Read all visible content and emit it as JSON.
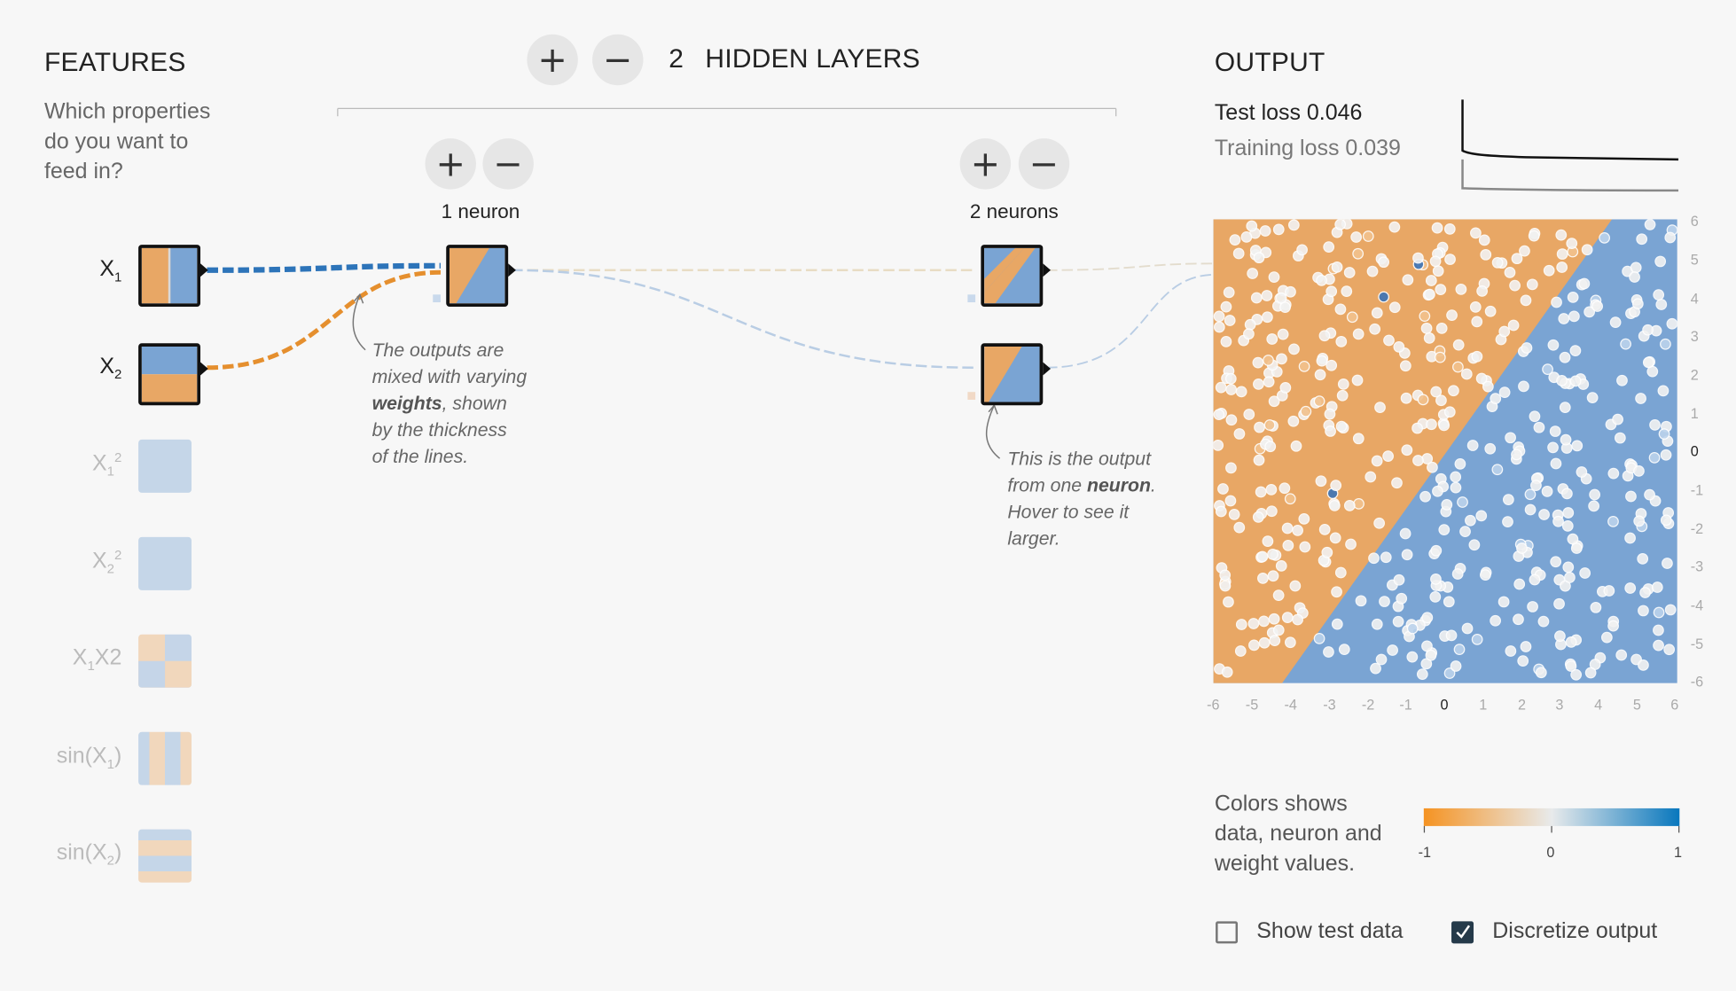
{
  "features": {
    "title": "FEATURES",
    "subtitle_lines": [
      "Which properties",
      "do you want to",
      "feed in?"
    ],
    "items": [
      {
        "base": "X",
        "sub": "1",
        "sup": "",
        "suffix": "",
        "active": true
      },
      {
        "base": "X",
        "sub": "2",
        "sup": "",
        "suffix": "",
        "active": true
      },
      {
        "base": "X",
        "sub": "1",
        "sup": "2",
        "suffix": "",
        "active": false
      },
      {
        "base": "X",
        "sub": "2",
        "sup": "2",
        "suffix": "",
        "active": false
      },
      {
        "base": "X",
        "sub": "1",
        "sup": "",
        "suffix": "X2",
        "active": false
      },
      {
        "base": "sin(X",
        "sub": "1",
        "sup": "",
        "suffix": ")",
        "active": false
      },
      {
        "base": "sin(X",
        "sub": "2",
        "sup": "",
        "suffix": ")",
        "active": false
      }
    ]
  },
  "hidden_layers": {
    "add_icon": "plus-icon",
    "remove_icon": "minus-icon",
    "count": "2",
    "label": "HIDDEN LAYERS",
    "layers": [
      {
        "neurons_label": "1 neuron"
      },
      {
        "neurons_label": "2 neurons"
      }
    ]
  },
  "annotations": {
    "weights_lines": [
      "The outputs are",
      "mixed with varying",
      "weights",
      ", shown",
      "by the thickness",
      "of the lines."
    ],
    "neuron_lines": [
      "This is the output",
      "from one ",
      "neuron",
      ".",
      "Hover to see it",
      "larger."
    ]
  },
  "output": {
    "title": "OUTPUT",
    "test_loss_label": "Test loss 0.046",
    "training_loss_label": "Training loss 0.039",
    "axis_ticks_x": [
      "-6",
      "-5",
      "-4",
      "-3",
      "-2",
      "-1",
      "0",
      "1",
      "2",
      "3",
      "4",
      "5",
      "6"
    ],
    "axis_ticks_y": [
      "6",
      "5",
      "4",
      "3",
      "2",
      "1",
      "0",
      "-1",
      "-2",
      "-3",
      "-4",
      "-5",
      "-6"
    ],
    "legend_lines": [
      "Colors shows",
      "data, neuron and",
      "weight values."
    ],
    "scale_ticks": [
      "-1",
      "0",
      "1"
    ],
    "show_test_data_label": "Show test data",
    "show_test_data_checked": false,
    "discretize_label": "Discretize output",
    "discretize_checked": true,
    "check_icon": "checkmark-icon"
  },
  "colors": {
    "orange": "#e8a765",
    "blue": "#7aa4d3",
    "orange_strong": "#f59322",
    "blue_strong": "#0877bd",
    "neutral": "#e8eaeb"
  }
}
